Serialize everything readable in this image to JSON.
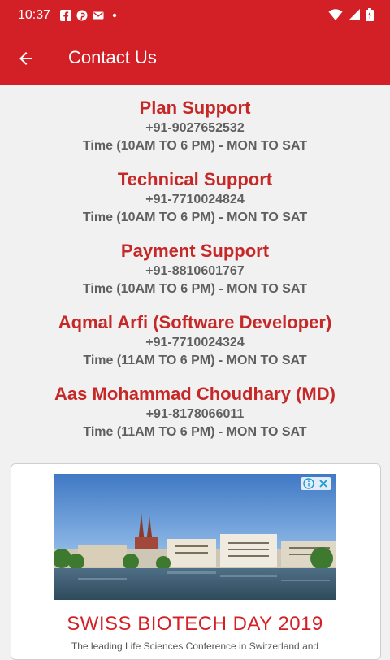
{
  "status_bar": {
    "time": "10:37",
    "notification_icons": [
      "facebook-icon",
      "pinterest-icon",
      "gmail-icon",
      "dot-icon"
    ],
    "system_icons": [
      "wifi-icon",
      "signal-icon",
      "battery-icon"
    ]
  },
  "app_bar": {
    "title": "Contact Us",
    "back_icon": "arrow-left-icon"
  },
  "contacts": [
    {
      "name": "Plan Support",
      "phone": "+91-9027652532",
      "hours": "Time (10AM TO 6 PM) - MON TO SAT"
    },
    {
      "name": "Technical Support",
      "phone": "+91-7710024824",
      "hours": "Time (10AM TO 6 PM) - MON TO SAT"
    },
    {
      "name": "Payment Support",
      "phone": "+91-8810601767",
      "hours": "Time (10AM TO 6 PM) - MON TO SAT"
    },
    {
      "name": "Aqmal Arfi (Software Developer)",
      "phone": "+91-7710024324",
      "hours": "Time (11AM TO 6 PM) - MON TO SAT"
    },
    {
      "name": "Aas Mohammad Choudhary (MD)",
      "phone": "+91-8178066011",
      "hours": "Time (11AM TO 6 PM) - MON TO SAT"
    }
  ],
  "ad": {
    "headline": "SWISS BIOTECH DAY 2019",
    "subtext": "The leading Life Sciences Conference in Switzerland and",
    "info_icon": "info-icon",
    "close_icon": "close-icon"
  },
  "colors": {
    "primary": "#d32027",
    "contact_name": "#c62828",
    "contact_detail": "#5f5f5f",
    "background": "#f1f1f1"
  }
}
